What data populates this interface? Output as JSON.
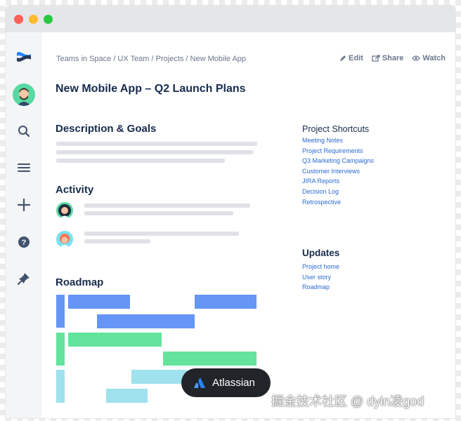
{
  "breadcrumb": "Teams in Space / UX Team / Projects / New Mobile App",
  "actions": {
    "edit": "Edit",
    "share": "Share",
    "watch": "Watch"
  },
  "page_title": "New Mobile App – Q2 Launch Plans",
  "sections": {
    "description": "Description & Goals",
    "activity": "Activity",
    "roadmap": "Roadmap",
    "shortcuts": "Project Shortcuts",
    "updates": "Updates"
  },
  "shortcuts": [
    "Meeting Notes",
    "Project Requirements",
    "Q3 Marketing Campaigns",
    "Customer Interviews",
    "JIRA Reports",
    "Decision Log",
    "Retrospective"
  ],
  "updates": [
    "Project home",
    "User story",
    "Roadmap"
  ],
  "toast": {
    "label": "Atlassian"
  },
  "watermark": "掘金技术社区 @ dyin凌god",
  "colors": {
    "blue": "#6596f5",
    "green": "#63e39c",
    "cyan": "#9fe1ec",
    "link": "#2a6bd1"
  },
  "icons": [
    "confluence-logo-icon",
    "user-avatar",
    "search-icon",
    "menu-icon",
    "plus-icon",
    "help-icon",
    "pin-icon",
    "edit-icon",
    "share-icon",
    "watch-icon",
    "atlassian-logo-icon"
  ]
}
